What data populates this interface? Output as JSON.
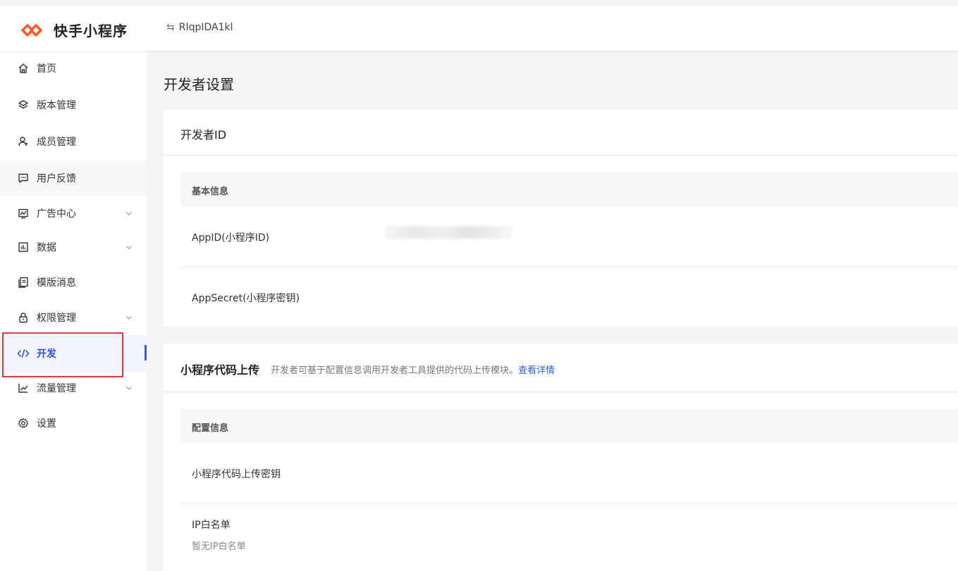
{
  "header": {
    "brand": "快手小程序",
    "app_switch_label": "RIqpIDA1kl",
    "brand_color": "#ff5a1f"
  },
  "sidebar": {
    "items": [
      {
        "label": "首页",
        "icon": "home-icon"
      },
      {
        "label": "版本管理",
        "icon": "layers-icon"
      },
      {
        "label": "成员管理",
        "icon": "user-icon"
      },
      {
        "label": "用户反馈",
        "icon": "message-icon"
      },
      {
        "label": "广告中心",
        "icon": "ad-icon",
        "expandable": true
      },
      {
        "label": "数据",
        "icon": "bar-chart-icon",
        "expandable": true
      },
      {
        "label": "模版消息",
        "icon": "template-icon"
      },
      {
        "label": "权限管理",
        "icon": "lock-icon",
        "expandable": true
      },
      {
        "label": "开发",
        "icon": "code-icon",
        "active": true
      },
      {
        "label": "流量管理",
        "icon": "trend-icon",
        "expandable": true
      },
      {
        "label": "设置",
        "icon": "gear-icon"
      }
    ],
    "active_color": "#2b5fe3",
    "highlight_color": "#e23a3a"
  },
  "main": {
    "page_title": "开发者设置",
    "developer_id_card": {
      "title": "开发者ID",
      "section_title": "基本信息",
      "rows": [
        {
          "label": "AppID(小程序ID)"
        },
        {
          "label": "AppSecret(小程序密钥)"
        }
      ]
    },
    "upload_card": {
      "title": "小程序代码上传",
      "description": "开发者可基于配置信息调用开发者工具提供的代码上传模块。",
      "link_text": "查看详情",
      "section_title": "配置信息",
      "rows": [
        {
          "label": "小程序代码上传密钥"
        },
        {
          "label": "IP白名单",
          "hint": "暂无IP白名单"
        }
      ]
    }
  }
}
